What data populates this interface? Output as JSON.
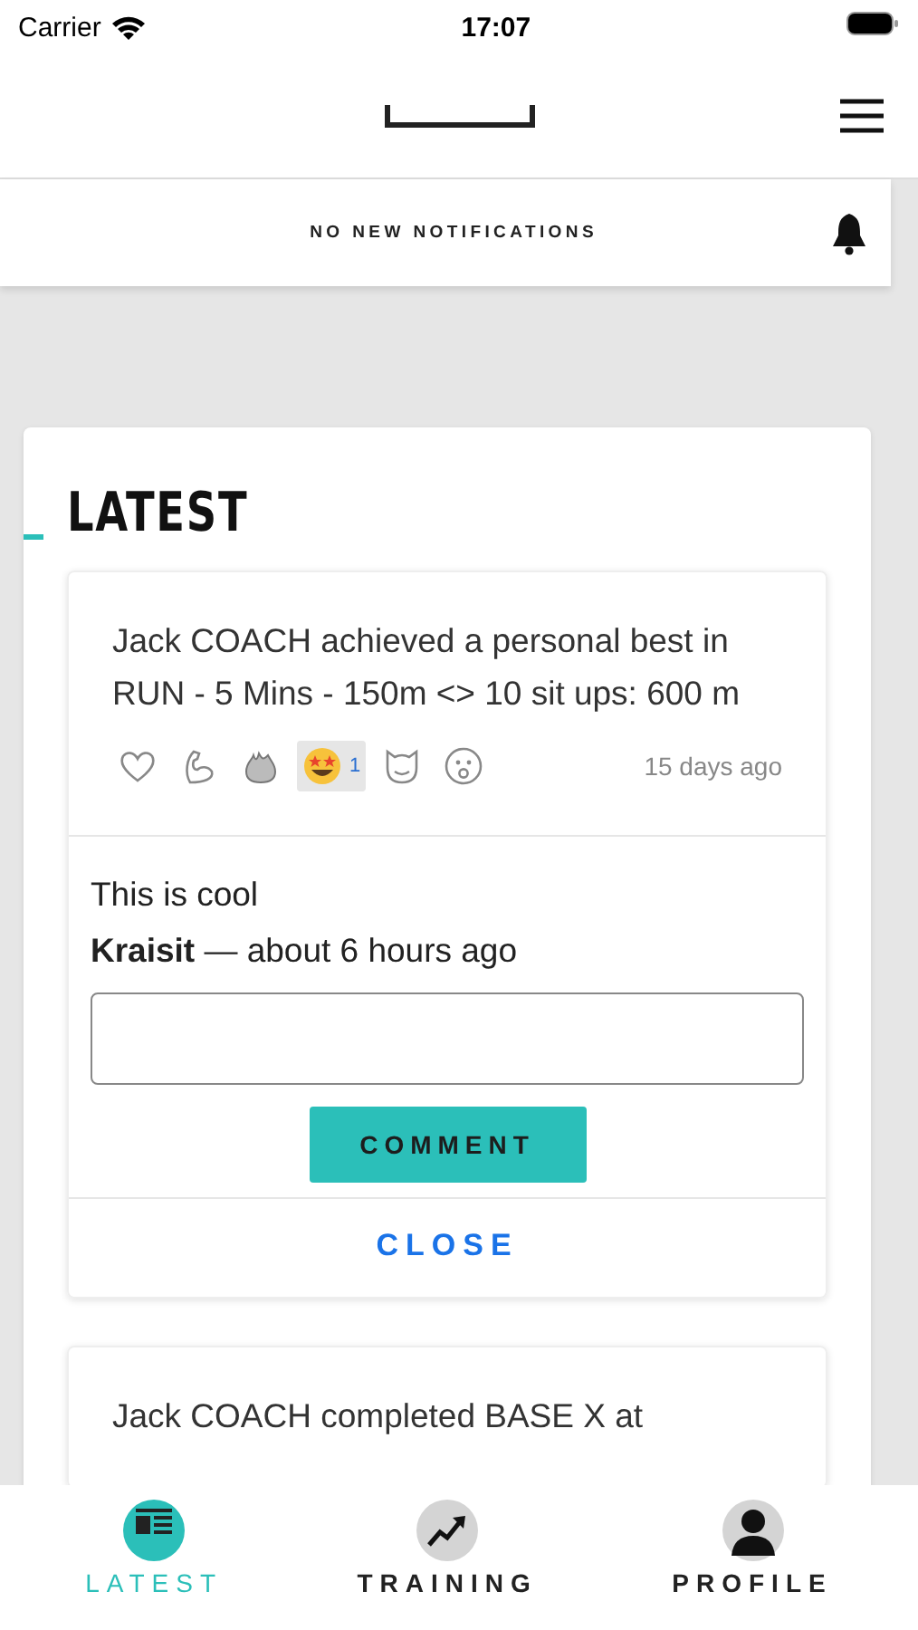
{
  "status_bar": {
    "carrier": "Carrier",
    "time": "17:07"
  },
  "notifications": {
    "text": "NO NEW NOTIFICATIONS"
  },
  "section_title": "LATEST",
  "feed": [
    {
      "text": "Jack COACH achieved a personal best in RUN - 5 Mins - 150m <> 10 sit ups: 600 m",
      "time": "15 days ago",
      "reactions": [
        {
          "kind": "heart",
          "selected": false
        },
        {
          "kind": "muscle",
          "selected": false
        },
        {
          "kind": "fire",
          "selected": false
        },
        {
          "kind": "starstruck",
          "selected": true,
          "count": "1"
        },
        {
          "kind": "cat",
          "selected": false
        },
        {
          "kind": "surprised",
          "selected": false
        }
      ],
      "comments": [
        {
          "text": "This is cool",
          "byline": "**Kraisit** — about 6 hours ago"
        }
      ],
      "comment_button": "COMMENT",
      "close_button": "CLOSE"
    },
    {
      "text": "Jack COACH completed BASE X at"
    }
  ],
  "tab_bar": [
    {
      "kind": "latest",
      "label": "LATEST",
      "selected": true
    },
    {
      "kind": "training",
      "label": "TRAINING",
      "selected": false
    },
    {
      "kind": "profile",
      "label": "PROFILE",
      "selected": false
    }
  ]
}
